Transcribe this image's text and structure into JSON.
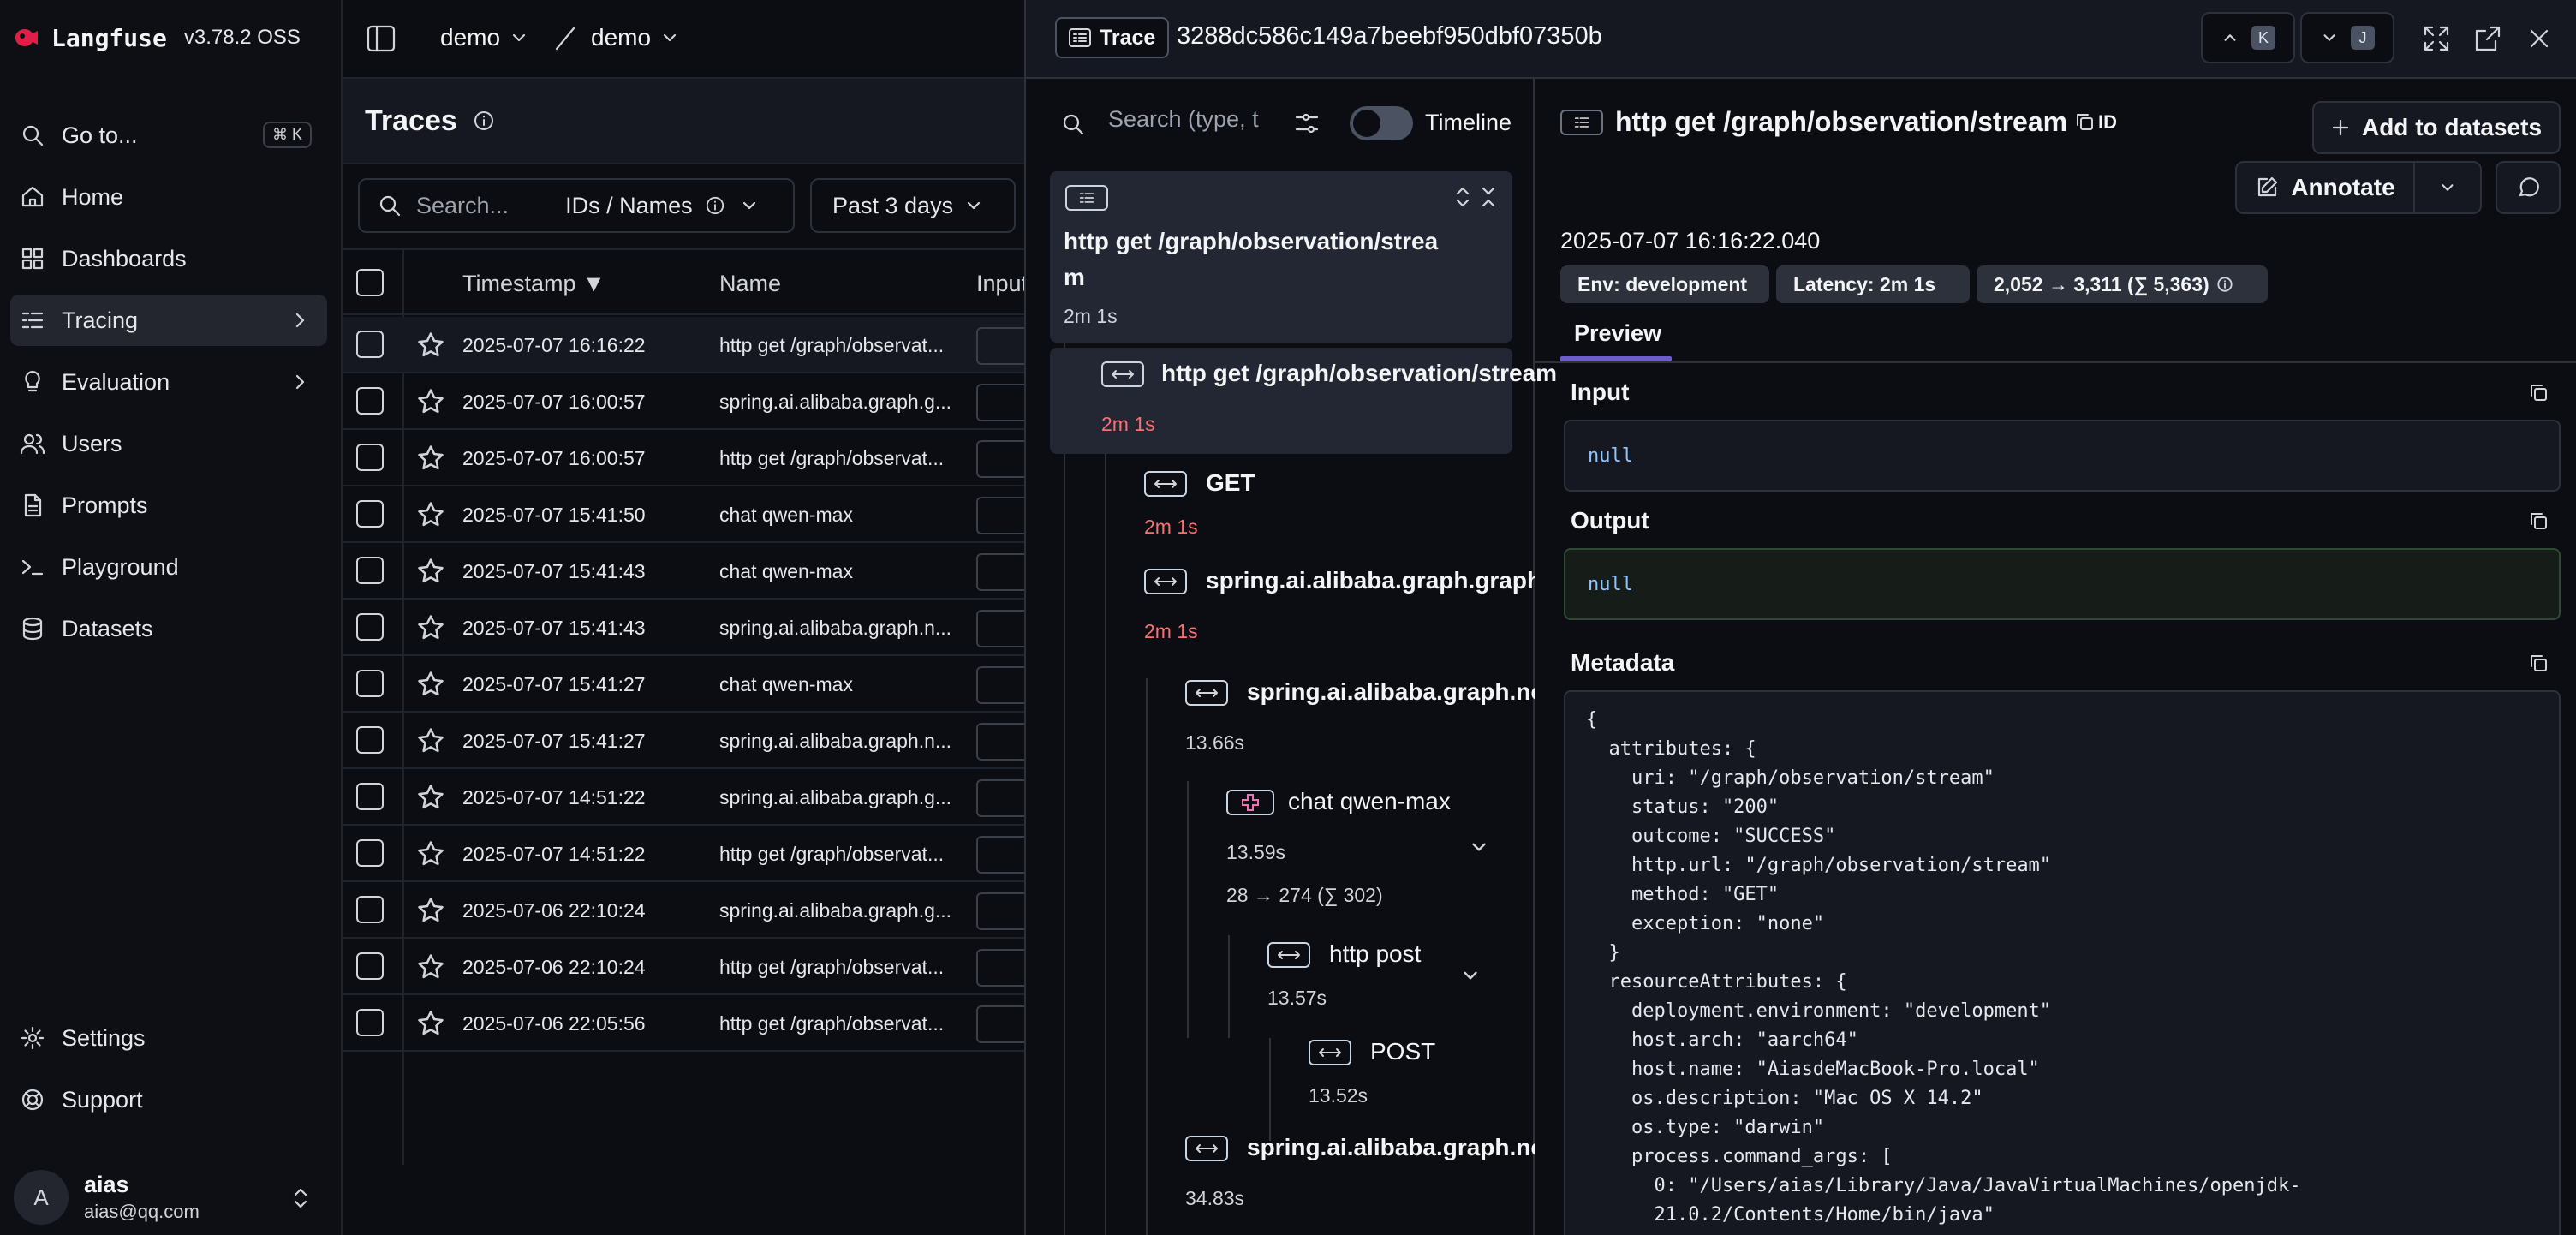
{
  "brand": {
    "name": "Langfuse",
    "version": "v3.78.2 OSS",
    "brand_color": "#e11d48"
  },
  "sidebar": {
    "goto": {
      "label": "Go to...",
      "shortcut": "⌘ K"
    },
    "items": [
      {
        "label": "Home",
        "icon": "home-icon"
      },
      {
        "label": "Dashboards",
        "icon": "dashboard-icon"
      },
      {
        "label": "Tracing",
        "icon": "tracing-icon",
        "active": true
      },
      {
        "label": "Evaluation",
        "icon": "lightbulb-icon"
      },
      {
        "label": "Users",
        "icon": "users-icon"
      },
      {
        "label": "Prompts",
        "icon": "file-icon"
      },
      {
        "label": "Playground",
        "icon": "terminal-icon"
      },
      {
        "label": "Datasets",
        "icon": "database-icon"
      }
    ],
    "footer": [
      {
        "label": "Settings",
        "icon": "gear-icon"
      },
      {
        "label": "Support",
        "icon": "support-icon"
      }
    ],
    "user": {
      "initial": "A",
      "name": "aias",
      "email": "aias@qq.com"
    }
  },
  "topbar": {
    "org": "demo",
    "project": "demo",
    "separator": "/"
  },
  "traces_page": {
    "title": "Traces",
    "search_placeholder": "Search...",
    "search_mode": "IDs / Names",
    "time_range": "Past 3 days",
    "columns": {
      "timestamp": "Timestamp ▼",
      "name": "Name",
      "input": "Input"
    },
    "rows": [
      {
        "timestamp": "2025-07-07 16:16:22",
        "name": "http get /graph/observat..."
      },
      {
        "timestamp": "2025-07-07 16:00:57",
        "name": "spring.ai.alibaba.graph.g..."
      },
      {
        "timestamp": "2025-07-07 16:00:57",
        "name": "http get /graph/observat..."
      },
      {
        "timestamp": "2025-07-07 15:41:50",
        "name": "chat qwen-max"
      },
      {
        "timestamp": "2025-07-07 15:41:43",
        "name": "chat qwen-max"
      },
      {
        "timestamp": "2025-07-07 15:41:43",
        "name": "spring.ai.alibaba.graph.n..."
      },
      {
        "timestamp": "2025-07-07 15:41:27",
        "name": "chat qwen-max"
      },
      {
        "timestamp": "2025-07-07 15:41:27",
        "name": "spring.ai.alibaba.graph.n..."
      },
      {
        "timestamp": "2025-07-07 14:51:22",
        "name": "spring.ai.alibaba.graph.g..."
      },
      {
        "timestamp": "2025-07-07 14:51:22",
        "name": "http get /graph/observat..."
      },
      {
        "timestamp": "2025-07-06 22:10:24",
        "name": "spring.ai.alibaba.graph.g..."
      },
      {
        "timestamp": "2025-07-06 22:10:24",
        "name": "http get /graph/observat..."
      },
      {
        "timestamp": "2025-07-06 22:05:56",
        "name": "http get /graph/observat..."
      }
    ]
  },
  "trace_panel": {
    "badge": "Trace",
    "trace_id": "3288dc586c149a7beebf950dbf07350b",
    "nav_up_key": "K",
    "nav_down_key": "J",
    "tree_search_placeholder": "Search (type, t",
    "timeline_label": "Timeline",
    "root": {
      "name_line1": "http get /graph/observation/strea",
      "name_line2": "m",
      "duration": "2m 1s"
    },
    "nodes": [
      {
        "name": "http get /graph/observation/stream",
        "duration": "2m 1s"
      },
      {
        "name": "GET",
        "duration": "2m 1s"
      },
      {
        "name": "spring.ai.alibaba.graph.graph-",
        "duration": "2m 1s"
      },
      {
        "name": "spring.ai.alibaba.graph.noc",
        "duration": "13.66s"
      },
      {
        "name": "chat qwen-max",
        "duration": "13.59s",
        "tokens": "28 → 274 (∑ 302)"
      },
      {
        "name": "http post",
        "duration": "13.57s"
      },
      {
        "name": "POST",
        "duration": "13.52s"
      },
      {
        "name": "spring.ai.alibaba.graph.noc",
        "duration": "34.83s"
      }
    ]
  },
  "details": {
    "title": "http get /graph/observation/stream",
    "id_label": "ID",
    "add_to_datasets": "Add to datasets",
    "annotate": "Annotate",
    "timestamp": "2025-07-07 16:16:22.040",
    "pills": {
      "env": "Env: development",
      "latency": "Latency: 2m 1s",
      "tokens": "2,052 → 3,311 (∑ 5,363)"
    },
    "tab": "Preview",
    "input_label": "Input",
    "input_value": "null",
    "output_label": "Output",
    "output_value": "null",
    "metadata_label": "Metadata",
    "metadata_lines": [
      "{",
      "  attributes: {",
      "    uri: \"/graph/observation/stream\"",
      "    status: \"200\"",
      "    outcome: \"SUCCESS\"",
      "    http.url: \"/graph/observation/stream\"",
      "    method: \"GET\"",
      "    exception: \"none\"",
      "  }",
      "  resourceAttributes: {",
      "    deployment.environment: \"development\"",
      "    host.arch: \"aarch64\"",
      "    host.name: \"AiasdeMacBook-Pro.local\"",
      "    os.description: \"Mac OS X 14.2\"",
      "    os.type: \"darwin\"",
      "    process.command_args: [",
      "      0: \"/Users/aias/Library/Java/JavaVirtualMachines/openjdk-",
      "      21.0.2/Contents/Home/bin/java\""
    ]
  }
}
